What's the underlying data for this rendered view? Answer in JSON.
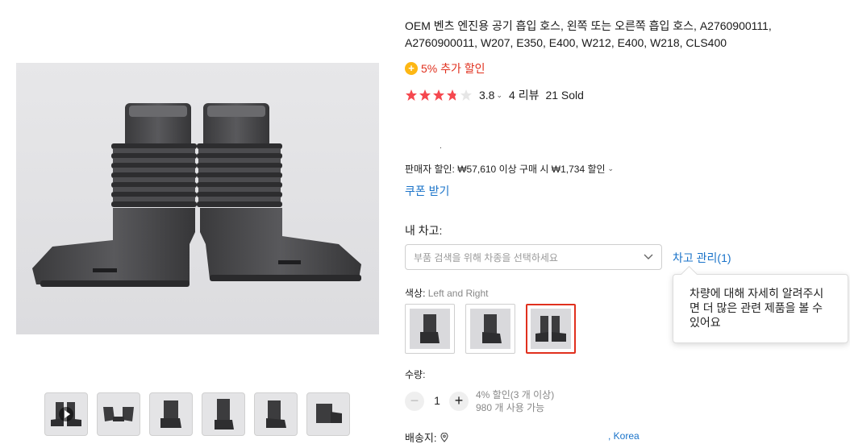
{
  "product": {
    "title": "OEM 벤츠 엔진용 공기 흡입 호스, 왼쪽 또는 오른쪽 흡입 호스, A2760900111, A2760900011, W207, E350, E400, W212, E400, W218, CLS400",
    "promo_text": "5% 추가 할인",
    "promo_icon": "plus-badge-icon",
    "rating": {
      "value": "3.8",
      "stars": 3.8,
      "reviews": "4 리뷰",
      "sold": "21 Sold",
      "star_color": "#f5484f",
      "star_empty_color": "#e6e6e6"
    },
    "price_dot": ".",
    "seller_discount": "판매자 할인: ₩57,610 이상 구매 시 ₩1,734 할인",
    "coupon_link": "쿠폰 받기",
    "garage": {
      "label": "내 차고:",
      "select_placeholder": "부품 검색을 위해 차종을 선택하세요",
      "manage_link": "차고 관리(1)",
      "tooltip": "차량에 대해 자세히 알려주시면 더 많은 관련 제품을 볼 수 있어요"
    },
    "color": {
      "label": "색상: ",
      "value": "Left and Right",
      "selected_index": 2
    },
    "quantity": {
      "label": "수량:",
      "value": "1",
      "minus": "−",
      "plus": "+",
      "discount_note": "4% 할인(3 개 이상)",
      "stock_note": "980 개 사용 가능"
    },
    "shipping": {
      "label": "배송지:",
      "country": ", Korea"
    }
  },
  "colors": {
    "accent_red": "#e0301e",
    "link_blue": "#1a73c9",
    "promo_yellow": "#fdb714"
  }
}
